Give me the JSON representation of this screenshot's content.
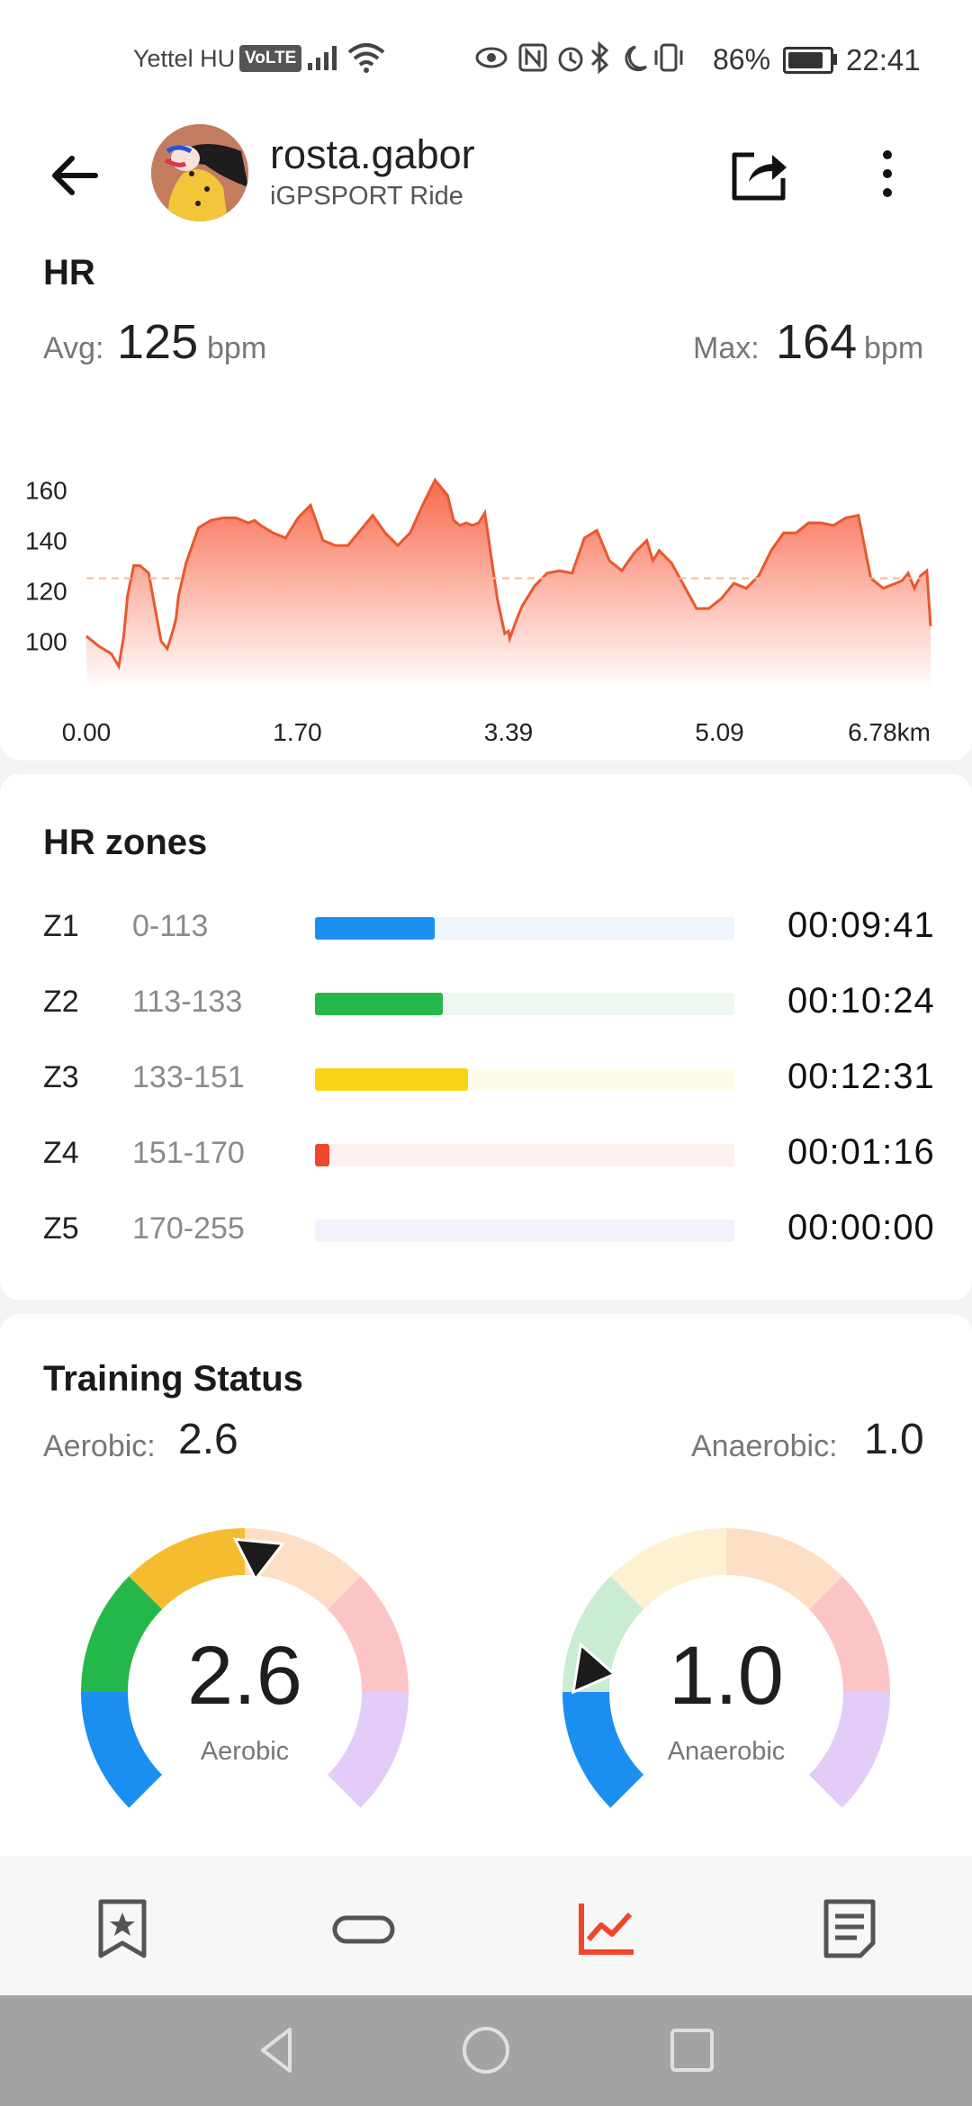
{
  "status_bar": {
    "carrier": "Yettel HU",
    "volte": "VoLTE",
    "icons": [
      "eye-icon",
      "nfc-icon",
      "alarm-icon",
      "bluetooth-icon",
      "moon-icon",
      "vibrate-icon"
    ],
    "battery_percent_label": "86%",
    "battery_level": 0.86,
    "time": "22:41"
  },
  "header": {
    "username": "rosta.gabor",
    "subtitle": "iGPSPORT Ride"
  },
  "hr": {
    "title": "HR",
    "avg_label": "Avg:",
    "avg_value": "125",
    "max_label": "Max:",
    "max_value": "164",
    "unit": "bpm"
  },
  "chart_data": {
    "type": "area",
    "title": "",
    "xlabel": "",
    "ylabel": "",
    "x_tick_labels": [
      "0.00",
      "1.70",
      "3.39",
      "5.09",
      "6.78km"
    ],
    "y_tick_labels": [
      "160",
      "140",
      "120",
      "100"
    ],
    "y_ticks": [
      160,
      140,
      120,
      100
    ],
    "xlim": [
      0,
      6.78
    ],
    "ylim": [
      83,
      167
    ],
    "avg_line": 125,
    "fill_color": "#f96a4e",
    "series": [
      {
        "x": [
          0.0,
          0.1,
          0.2,
          0.26,
          0.3,
          0.33,
          0.38,
          0.43,
          0.5,
          0.6,
          0.65,
          0.7,
          0.72,
          0.74,
          0.8,
          0.9,
          1.0,
          1.1,
          1.2,
          1.3,
          1.35,
          1.4,
          1.5,
          1.6,
          1.7,
          1.8,
          1.9,
          2.0,
          2.1,
          2.2,
          2.3,
          2.4,
          2.5,
          2.6,
          2.7,
          2.8,
          2.9,
          2.95,
          3.0,
          3.05,
          3.1,
          3.15,
          3.2,
          3.3,
          3.36,
          3.39,
          3.4,
          3.45,
          3.5,
          3.6,
          3.7,
          3.8,
          3.9,
          4.0,
          4.1,
          4.2,
          4.3,
          4.4,
          4.5,
          4.55,
          4.6,
          4.7,
          4.8,
          4.9,
          5.0,
          5.1,
          5.2,
          5.3,
          5.4,
          5.5,
          5.6,
          5.7,
          5.8,
          5.9,
          6.0,
          6.1,
          6.2,
          6.3,
          6.4,
          6.5,
          6.55,
          6.6,
          6.65,
          6.7,
          6.75,
          6.78
        ],
        "y": [
          102,
          98,
          95,
          90,
          102,
          118,
          130,
          130,
          127,
          100,
          97,
          105,
          109,
          118,
          131,
          145,
          148,
          149,
          149,
          147,
          148,
          146,
          143,
          141,
          149,
          154,
          140,
          138,
          138,
          144,
          150,
          143,
          138,
          143,
          154,
          164,
          158,
          148,
          146,
          147,
          146,
          147,
          151,
          117,
          103,
          104,
          101,
          108,
          114,
          122,
          127,
          128,
          127,
          141,
          144,
          132,
          128,
          135,
          140,
          132,
          136,
          131,
          122,
          113,
          113,
          117,
          123,
          121,
          126,
          136,
          143,
          143,
          147,
          147,
          146,
          149,
          150,
          125,
          121,
          123,
          124,
          127,
          121,
          126,
          128,
          106
        ]
      }
    ]
  },
  "zones": {
    "title": "HR zones",
    "rows": [
      {
        "name": "Z1",
        "range": "0-113",
        "time": "00:09:41",
        "fraction": 0.285,
        "color": "#1a8ff0",
        "track": "#eef5fc"
      },
      {
        "name": "Z2",
        "range": "113-133",
        "time": "00:10:24",
        "fraction": 0.305,
        "color": "#24b84b",
        "track": "#eef8f0"
      },
      {
        "name": "Z3",
        "range": "133-151",
        "time": "00:12:31",
        "fraction": 0.364,
        "color": "#fad418",
        "track": "#fffbeb"
      },
      {
        "name": "Z4",
        "range": "151-170",
        "time": "00:01:16",
        "fraction": 0.035,
        "color": "#f2462a",
        "track": "#fdf0ee"
      },
      {
        "name": "Z5",
        "range": "170-255",
        "time": "00:00:00",
        "fraction": 0.0,
        "color": "#c9a3ec",
        "track": "#f4f0fc"
      }
    ]
  },
  "training": {
    "title": "Training Status",
    "aerobic_label": "Aerobic:",
    "aerobic_value": "2.6",
    "anaerobic_label": "Anaerobic:",
    "anaerobic_value": "1.0",
    "gauge_aerobic": {
      "value": "2.6",
      "label": "Aerobic",
      "level": 2.6,
      "max": 5.0
    },
    "gauge_anaerobic": {
      "value": "1.0",
      "label": "Anaerobic",
      "level": 1.0,
      "max": 5.0
    },
    "colors_active": [
      "#1a8ff0",
      "#24b84b",
      "#f5bc2f",
      "#fbc99c",
      "#f26f6f",
      "#c49af0"
    ],
    "colors_dim": [
      "#1a8ff0",
      "#24b84b",
      "#f5bc2f",
      "#fddfc6",
      "#fcc5c5",
      "#e4ccf8"
    ],
    "colors_anaerobic_dim": [
      "#1a8ff0",
      "#c9ecd2",
      "#fdf1d2",
      "#fddfc6",
      "#fcc5c5",
      "#e4ccf8"
    ]
  },
  "bottom_nav": {
    "items": [
      "bookmark-star-icon",
      "track-loop-icon",
      "chart-icon",
      "document-icon"
    ],
    "active_index": 2,
    "active_color": "#f2462a"
  }
}
